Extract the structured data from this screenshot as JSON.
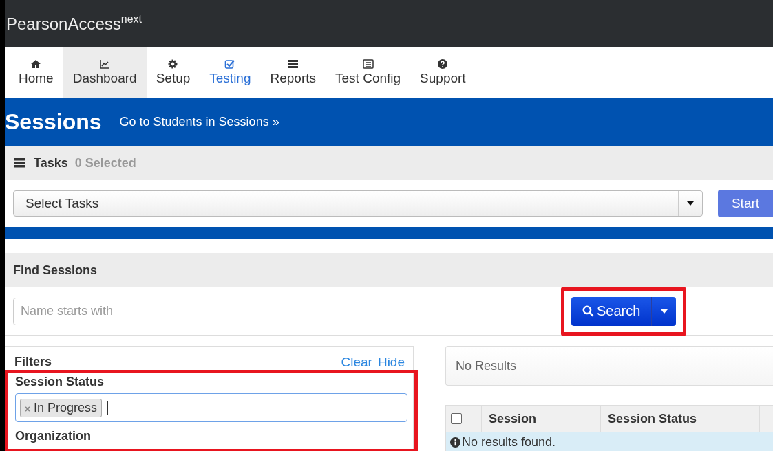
{
  "app": {
    "brand": "PearsonAccess",
    "brand_suffix": "next"
  },
  "nav": [
    {
      "label": "Home",
      "kind": "home",
      "selected": false,
      "active": false
    },
    {
      "label": "Dashboard",
      "kind": "chart",
      "selected": true,
      "active": false
    },
    {
      "label": "Setup",
      "kind": "gear",
      "selected": false,
      "active": false
    },
    {
      "label": "Testing",
      "kind": "check",
      "selected": false,
      "active": true
    },
    {
      "label": "Reports",
      "kind": "stack",
      "selected": false,
      "active": false
    },
    {
      "label": "Test Config",
      "kind": "list",
      "selected": false,
      "active": false
    },
    {
      "label": "Support",
      "kind": "question",
      "selected": false,
      "active": false
    }
  ],
  "page": {
    "title": "Sessions",
    "link": "Go to Students in Sessions »"
  },
  "tasks": {
    "label": "Tasks",
    "count": "0 Selected",
    "select": "Select Tasks",
    "start": "Start"
  },
  "find": {
    "title": "Find Sessions",
    "placeholder": "Name starts with",
    "search": "Search",
    "highlighted": true
  },
  "filters": {
    "title": "Filters",
    "links": [
      "Clear",
      "Hide"
    ],
    "highlighted": true,
    "groups": [
      {
        "label": "Session Status",
        "tags": [
          "In Progress"
        ]
      },
      {
        "label": "Organization"
      }
    ]
  },
  "results": {
    "summary": "No Results",
    "select_all": {
      "checked": false
    },
    "columns": [
      "Session",
      "Session Status"
    ],
    "empty": "No results found."
  }
}
